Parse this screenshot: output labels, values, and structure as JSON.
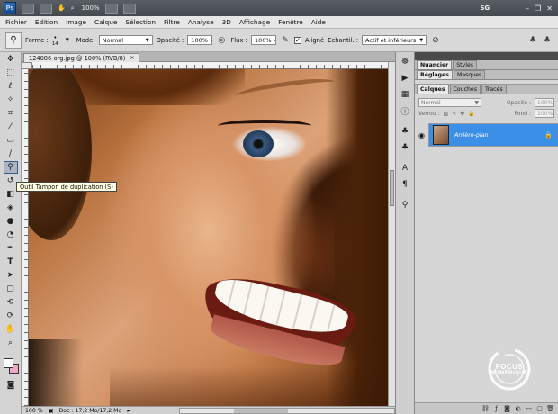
{
  "app": {
    "logo": "Ps",
    "zoom": "100%",
    "workspace": "SG"
  },
  "menu": [
    "Fichier",
    "Edition",
    "Image",
    "Calque",
    "Sélection",
    "Filtre",
    "Analyse",
    "3D",
    "Affichage",
    "Fenêtre",
    "Aide"
  ],
  "options": {
    "forme_label": "Forme :",
    "brush_size": "14",
    "mode_label": "Mode:",
    "mode_value": "Normal",
    "opacite_label": "Opacité :",
    "opacite_value": "100%",
    "flux_label": "Flux :",
    "flux_value": "100%",
    "aligne_label": "Aligné",
    "echantillon_label": "Echantil. :",
    "echantillon_value": "Actif et inférieurs"
  },
  "document": {
    "tab_title": "124086-org.jpg @ 100% (RVB/8)",
    "close": "×"
  },
  "tooltip": "Outil Tampon de duplication (S)",
  "status": {
    "zoom": "100 %",
    "doc_info": "Doc : 17,2 Mo/17,2 Mo"
  },
  "panels": {
    "top_tabs": [
      "Nuancier",
      "Styles"
    ],
    "mid_tabs": [
      "Réglages",
      "Masques"
    ],
    "layer_tabs": [
      "Calques",
      "Couches",
      "Tracés"
    ],
    "blend_mode": "Normal",
    "opacity_label": "Opacité :",
    "opacity_value": "100%",
    "lock_label": "Verrou :",
    "fill_label": "Fond :",
    "fill_value": "100%",
    "layer_name": "Arrière-plan"
  },
  "watermark": {
    "line1": "FOCUS",
    "line2": "NUMÉRIQUE"
  },
  "colors": {
    "layer_selected": "#3b8fe6",
    "background_swatch": "#f0a8c8",
    "ps_blue": "#2b6cb8"
  }
}
